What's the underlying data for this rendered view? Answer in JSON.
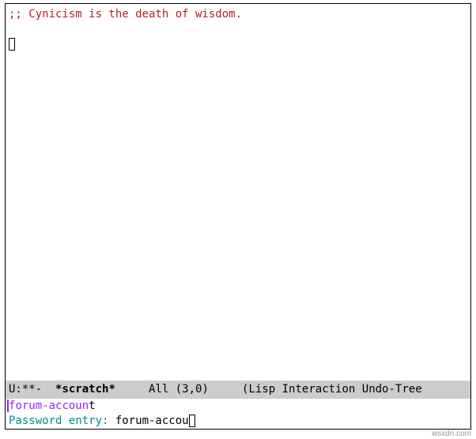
{
  "buffer": {
    "comment_line": ";; Cynicism is the death of wisdom."
  },
  "modeline": {
    "left": "U:**-  ",
    "buffer_name": "*scratch*",
    "gap1": "     ",
    "position": "All (3,0)",
    "gap2": "     ",
    "modes": "(Lisp Interaction Undo-Tree"
  },
  "minibuffer": {
    "completion_prefix_char": "f",
    "completion_prefix_rest": "orum-accoun",
    "completion_tail": "t",
    "prompt": "Password entry: ",
    "input": "forum-accou"
  },
  "watermark": "wsxdn.com"
}
